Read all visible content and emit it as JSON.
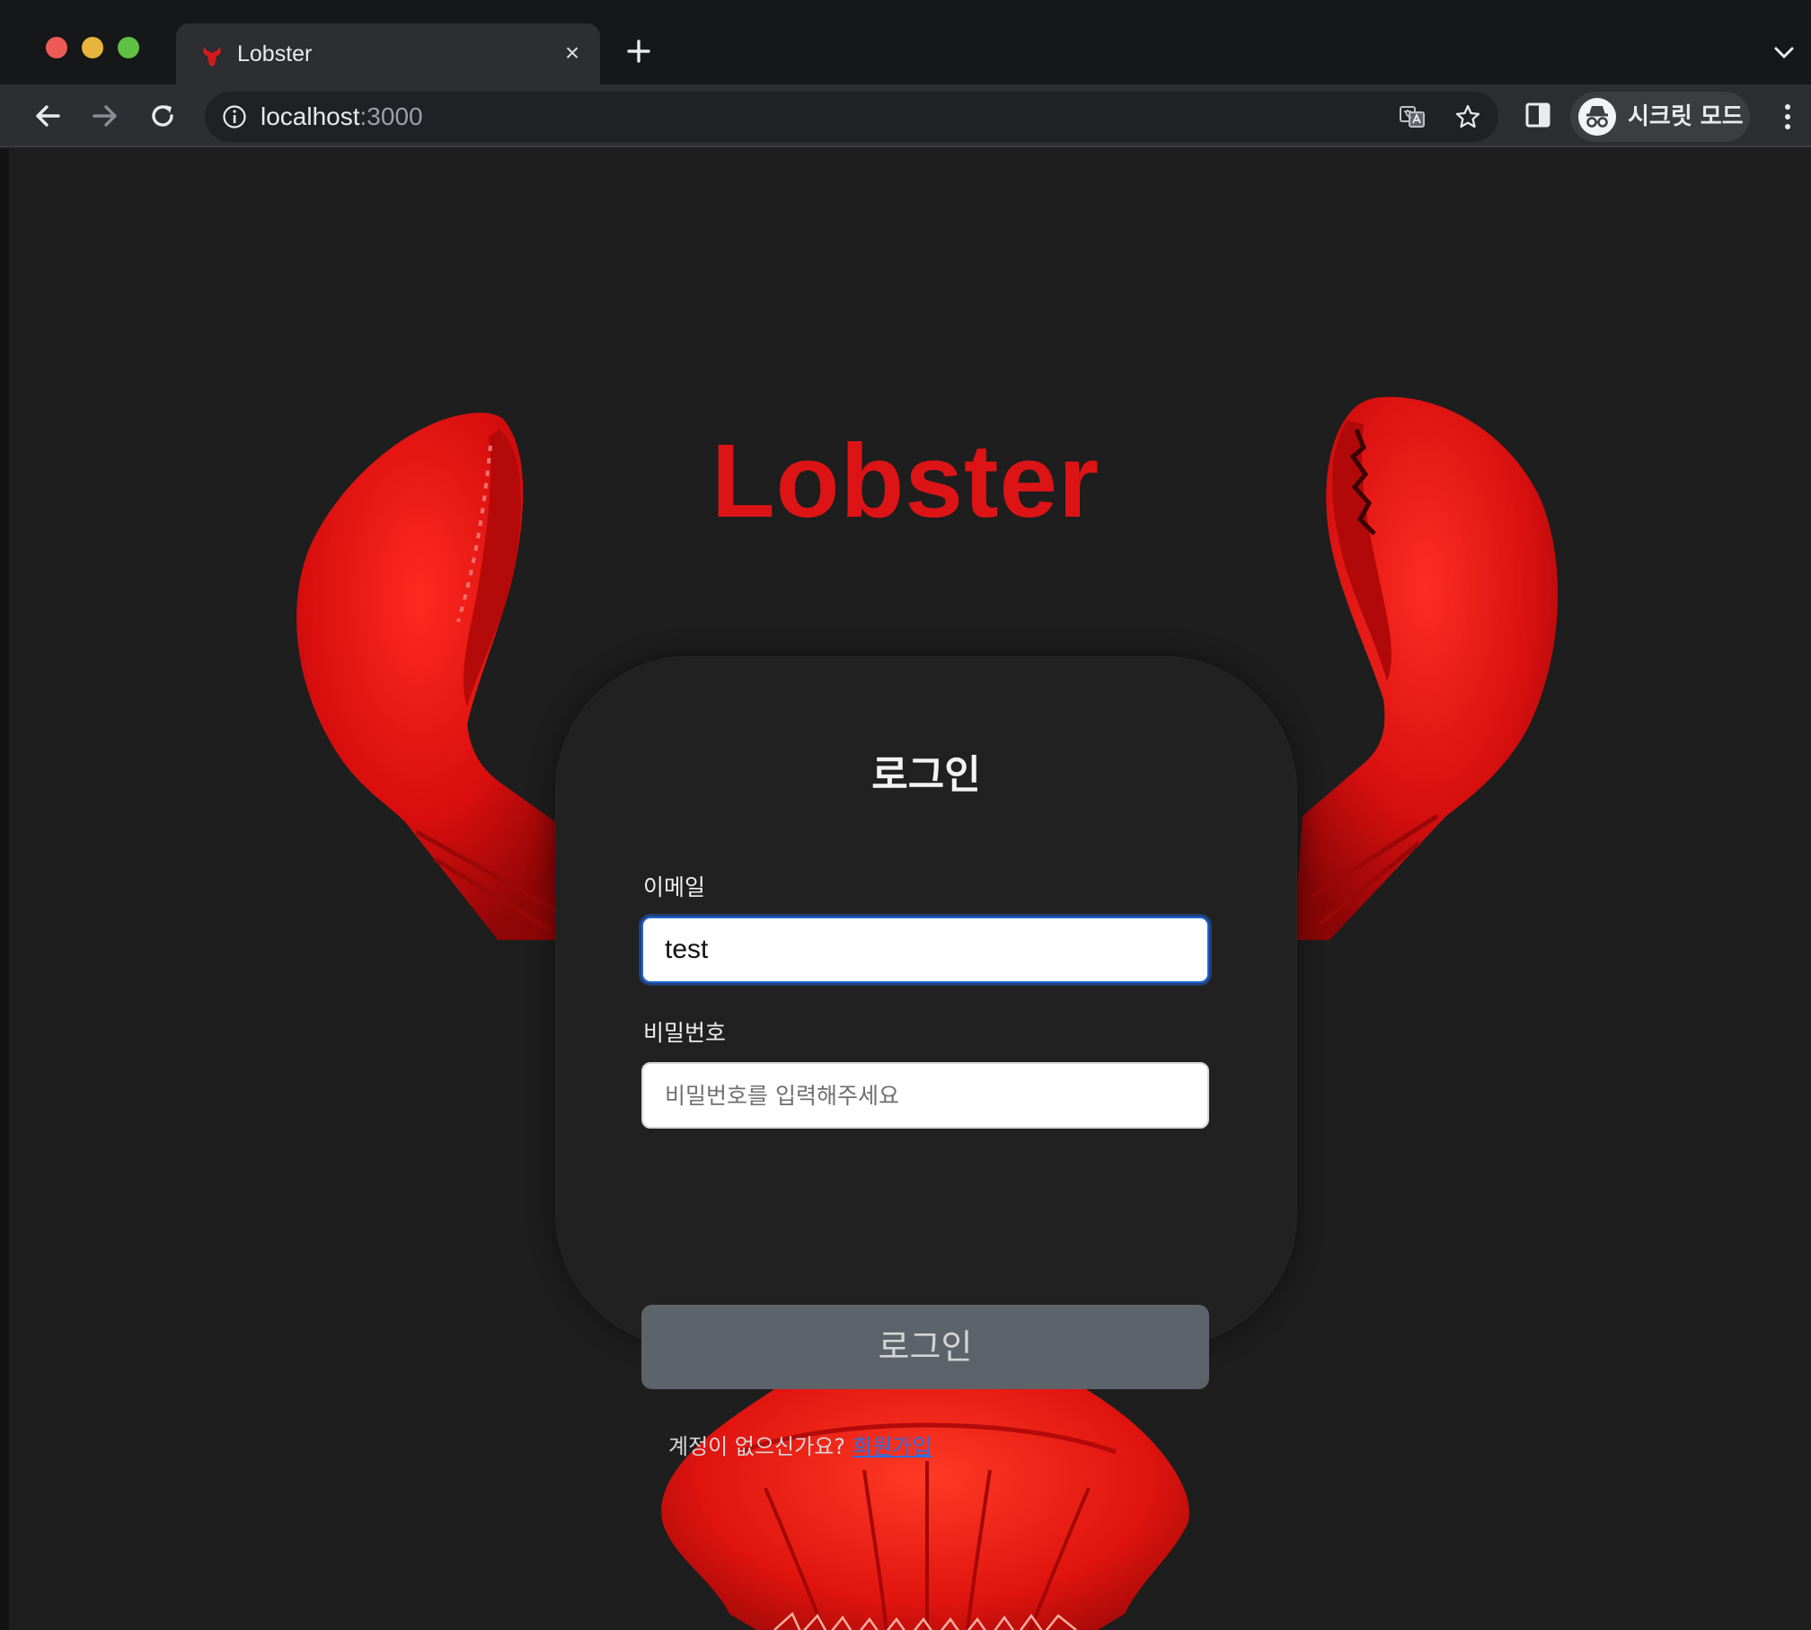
{
  "browser": {
    "tab": {
      "title": "Lobster",
      "close_symbol": "×"
    },
    "new_tab_symbol": "+",
    "address": {
      "host": "localhost",
      "port": ":3000"
    },
    "incognito_label": "시크릿 모드",
    "icons": {
      "tab_favicon": "lobster-favicon-icon",
      "new_tab": "plus-icon",
      "back": "arrow-left-icon",
      "forward": "arrow-right-icon",
      "reload": "reload-icon",
      "site_info": "info-icon",
      "translate": "translate-icon",
      "bookmark": "star-icon",
      "side_panel": "side-panel-icon",
      "incognito": "incognito-icon",
      "menu": "kebab-menu-icon",
      "tab_search": "chevron-down-icon"
    }
  },
  "page": {
    "brand_title": "Lobster",
    "login_card": {
      "title": "로그인",
      "email": {
        "label": "이메일",
        "value": "test"
      },
      "password": {
        "label": "비밀번호",
        "placeholder": "비밀번호를 입력해주세요",
        "value": ""
      },
      "submit_label": "로그인",
      "signup_prompt": "계정이 없으신가요?",
      "signup_link": "회원가입"
    },
    "illustration": [
      "lobster-left-claw",
      "lobster-right-claw",
      "lobster-tail"
    ]
  },
  "colors": {
    "brand_red": "#dd1416",
    "page_background": "#1e1e1e",
    "card_background": "#212121",
    "button_gray": "#5c636a",
    "focus_blue": "#1e64d6",
    "link_blue": "#2f6ee0"
  }
}
